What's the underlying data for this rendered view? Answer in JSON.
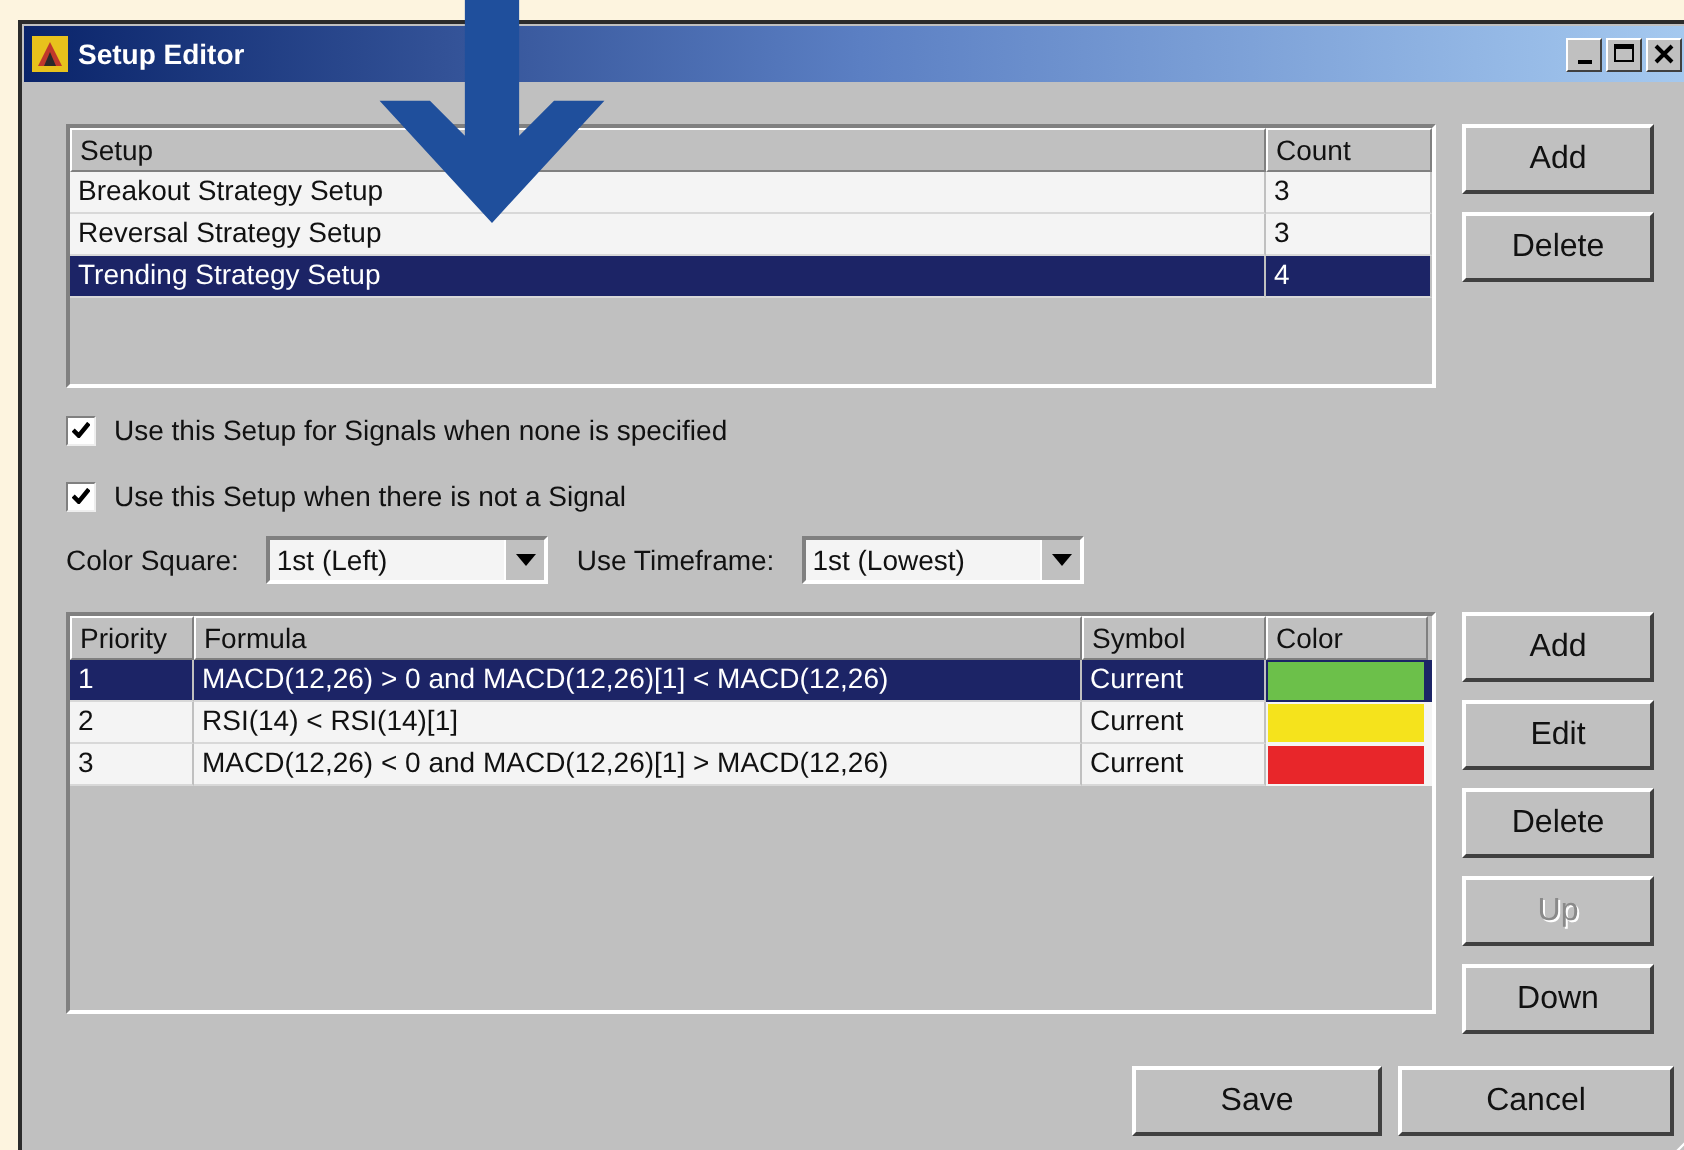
{
  "window": {
    "title": "Setup Editor"
  },
  "setups": {
    "columns": [
      "Setup",
      "Count"
    ],
    "rows": [
      {
        "name": "Breakout Strategy Setup",
        "count": "3",
        "selected": false
      },
      {
        "name": "Reversal Strategy Setup",
        "count": "3",
        "selected": false
      },
      {
        "name": "Trending Strategy Setup",
        "count": "4",
        "selected": true
      }
    ],
    "buttons": [
      {
        "label": "Add",
        "disabled": false
      },
      {
        "label": "Delete",
        "disabled": false
      }
    ]
  },
  "options": [
    {
      "label": "Use this Setup for Signals when none is specified",
      "checked": true
    },
    {
      "label": "Use this Setup when there is not a Signal",
      "checked": true
    }
  ],
  "selects": [
    {
      "label": "Color Square:",
      "value": "1st (Left)"
    },
    {
      "label": "Use Timeframe:",
      "value": "1st (Lowest)"
    }
  ],
  "formulas": {
    "columns": [
      "Priority",
      "Formula",
      "Symbol",
      "Color"
    ],
    "rows": [
      {
        "priority": "1",
        "formula": "MACD(12,26) > 0 and MACD(12,26)[1] < MACD(12,26)",
        "symbol": "Current",
        "color": "#6cc04a",
        "selected": true
      },
      {
        "priority": "2",
        "formula": "RSI(14) < RSI(14)[1]",
        "symbol": "Current",
        "color": "#f5e31c",
        "selected": false
      },
      {
        "priority": "3",
        "formula": "MACD(12,26) < 0 and MACD(12,26)[1] > MACD(12,26)",
        "symbol": "Current",
        "color": "#e8262a",
        "selected": false
      }
    ],
    "buttons": [
      {
        "label": "Add",
        "disabled": false
      },
      {
        "label": "Edit",
        "disabled": false
      },
      {
        "label": "Delete",
        "disabled": false
      },
      {
        "label": "Up",
        "disabled": true
      },
      {
        "label": "Down",
        "disabled": false
      }
    ]
  },
  "footer_buttons": [
    {
      "label": "Save",
      "disabled": false
    },
    {
      "label": "Cancel",
      "disabled": false
    }
  ]
}
